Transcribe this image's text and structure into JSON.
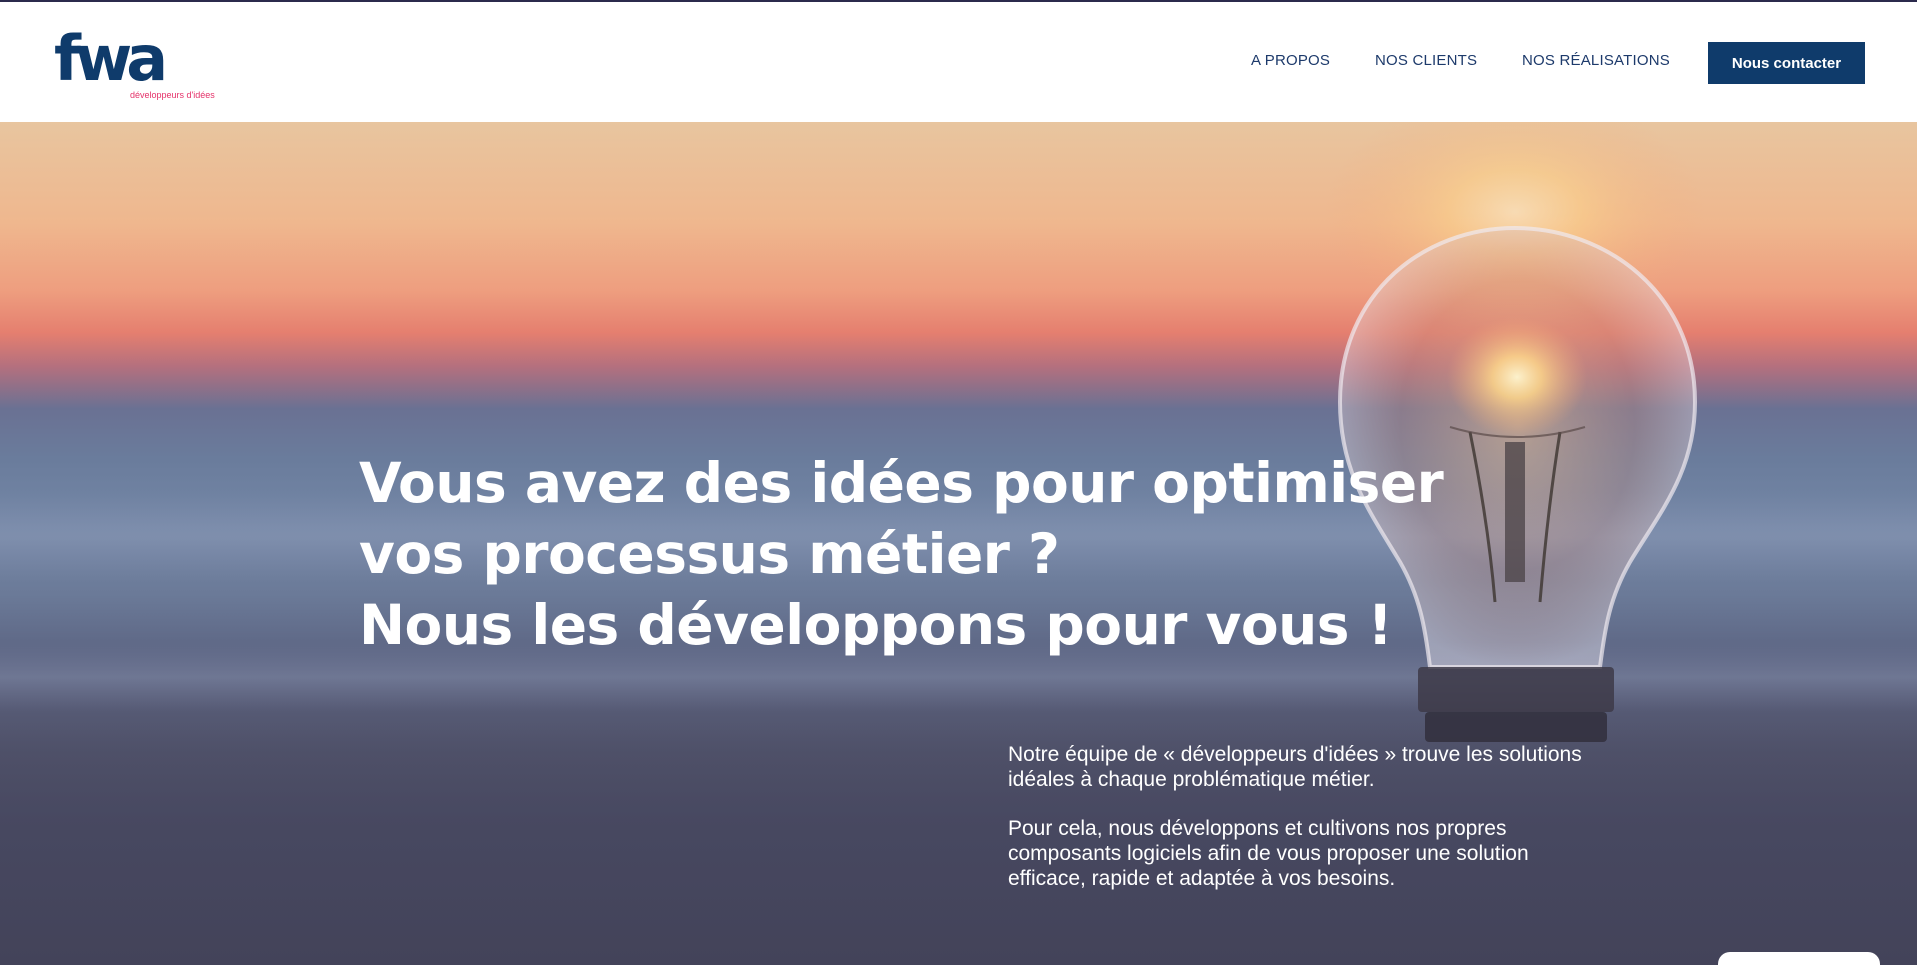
{
  "logo": {
    "letters": "fwa",
    "tagline": "développeurs d'idées"
  },
  "nav": {
    "about": "A PROPOS",
    "clients": "NOS CLIENTS",
    "work": "NOS RÉALISATIONS",
    "contact": "Nous contacter"
  },
  "hero": {
    "headline": [
      "Vous avez des idées pour optimiser",
      "vos processus métier ?",
      "Nous les développons pour vous !"
    ],
    "paragraphs": [
      "Notre équipe de « développeurs d'idées » trouve les solutions idéales à chaque problématique métier.",
      "Pour cela, nous développons et cultivons nos propres composants logiciels afin de vous proposer une solution efficace, rapide et adaptée à vos besoins."
    ]
  },
  "colors": {
    "brand_navy": "#0f3b6b",
    "brand_pink": "#e5326a",
    "nav_text": "#1d3a6b"
  }
}
